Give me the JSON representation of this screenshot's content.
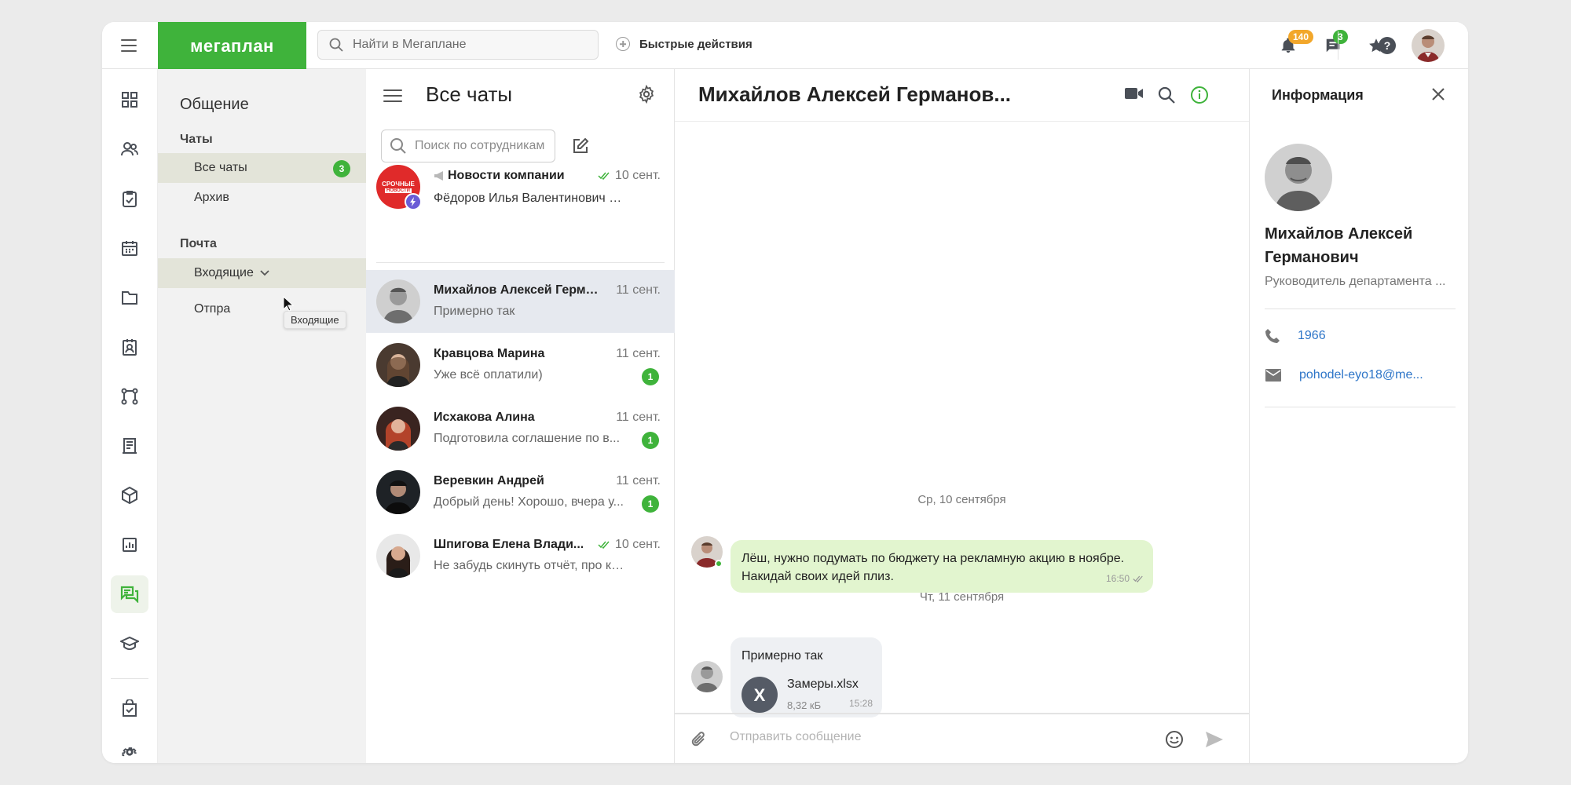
{
  "header": {
    "logo": "мегаплан",
    "search_placeholder": "Найти в Мегаплане",
    "quick_actions": "Быстрые действия",
    "notifications_count": "140",
    "messages_count": "3"
  },
  "sections": {
    "title": "Общение",
    "chats_heading": "Чаты",
    "chats_items": [
      {
        "label": "Все чаты",
        "badge": "3"
      },
      {
        "label": "Архив"
      }
    ],
    "mail_heading": "Почта",
    "mail_items": [
      {
        "label": "Входящие"
      },
      {
        "label": "Отпра"
      }
    ],
    "tooltip": "Входящие"
  },
  "chat_list": {
    "title": "Все чаты",
    "search_placeholder": "Поиск по сотрудникам",
    "chats": [
      {
        "name": "Новости компании",
        "date": "10 сент.",
        "preview": "Фёдоров Илья Валентинович 💻 Н...",
        "avatar_text": "СРОЧНЫЕ",
        "avatar_subtext": "НОВОСТИ",
        "read": true
      },
      {
        "name": "Михайлов Алексей Герма...",
        "date": "11 сент.",
        "preview": "Примерно так"
      },
      {
        "name": "Кравцова Марина",
        "date": "11 сент.",
        "preview": "Уже всё оплатили)",
        "unread": "1"
      },
      {
        "name": "Исхакова Алина",
        "date": "11 сент.",
        "preview": "Подготовила соглашение по в...",
        "unread": "1"
      },
      {
        "name": "Веревкин Андрей",
        "date": "11 сент.",
        "preview": "Добрый день! Хорошо, вчера у...",
        "unread": "1"
      },
      {
        "name": "Шпигова Елена Влади...",
        "date": "10 сент.",
        "preview": "Не забудь скинуть отчёт, про котор...",
        "read": true
      }
    ]
  },
  "conversation": {
    "title": "Михайлов Алексей Германов...",
    "date1": "Ср, 10 сентября",
    "msg1_text": "Лёш, нужно подумать по бюджету на рекламную акцию в ноябре. Накидай своих идей плиз.",
    "msg1_time": "16:50",
    "date2": "Чт, 11 сентября",
    "msg2_text": "Примерно так",
    "file_name": "Замеры.xlsx",
    "file_size": "8,32 кБ",
    "file_letter": "X",
    "msg2_time": "15:28",
    "composer_placeholder": "Отправить сообщение"
  },
  "info_panel": {
    "title": "Информация",
    "name": "Михайлов Алексей Германович",
    "role": "Руководитель департамента ...",
    "phone": "1966",
    "email": "pohodel-eyo18@me..."
  },
  "colors": {
    "brand_green": "#3fb33b",
    "badge_orange": "#f2a72b",
    "outgoing_bubble": "#e2f5cf",
    "link_blue": "#2d75c8"
  },
  "icons": {
    "rail": [
      "dashboard-icon",
      "contacts-icon",
      "tasks-icon",
      "calendar-icon",
      "folder-icon",
      "employee-card-icon",
      "workflow-icon",
      "invoice-icon",
      "product-box-icon",
      "reports-icon",
      "chat-icon",
      "education-icon",
      "store-icon",
      "settings-icon"
    ]
  }
}
